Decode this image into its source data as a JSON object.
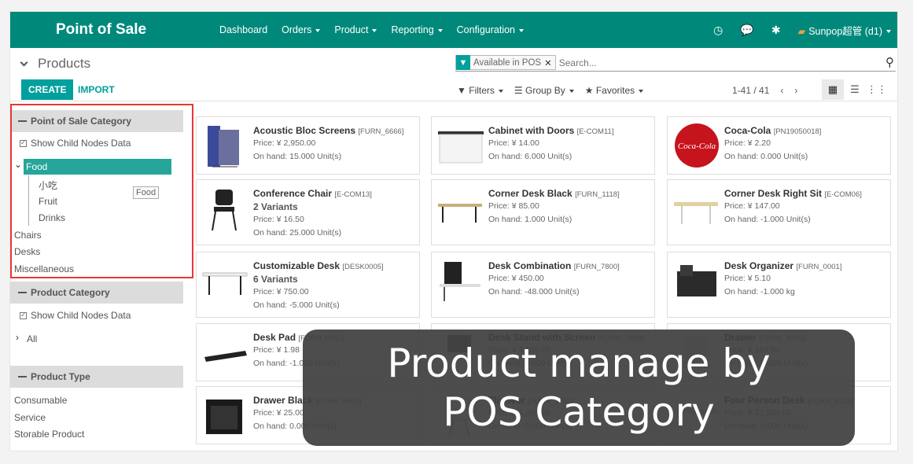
{
  "topbar": {
    "app_title": "Point of Sale",
    "menu": [
      "Dashboard",
      "Orders",
      "Product",
      "Reporting",
      "Configuration"
    ],
    "user": "Sunpop超管 (d1)",
    "color": "#00897b"
  },
  "control": {
    "breadcrumb": "Products",
    "create": "CREATE",
    "import": "IMPORT",
    "facet": "Available in POS",
    "search_placeholder": "Search...",
    "filters": "Filters",
    "group_by": "Group By",
    "favorites": "Favorites",
    "pager": "1-41 / 41"
  },
  "sidebar": {
    "pos_category": {
      "title": "Point of Sale Category",
      "show_child": "Show Child Nodes Data",
      "selected": "Food",
      "children": [
        "小吃",
        "Fruit",
        "Drinks"
      ],
      "others": [
        "Chairs",
        "Desks",
        "Miscellaneous"
      ],
      "tooltip": "Food"
    },
    "product_category": {
      "title": "Product Category",
      "show_child": "Show Child Nodes Data",
      "all": "All"
    },
    "product_type": {
      "title": "Product Type",
      "items": [
        "Consumable",
        "Service",
        "Storable Product"
      ]
    }
  },
  "cards": [
    {
      "name": "Acoustic Bloc Screens",
      "ref": "[FURN_6666]",
      "price": "Price: ¥ 2,950.00",
      "onhand": "On hand: 15.000 Unit(s)"
    },
    {
      "name": "Cabinet with Doors",
      "ref": "[E-COM11]",
      "price": "Price: ¥ 14.00",
      "onhand": "On hand: 6.000 Unit(s)"
    },
    {
      "name": "Coca-Cola",
      "ref": "[PN19050018]",
      "price": "Price: ¥ 2.20",
      "onhand": "On hand: 0.000 Unit(s)"
    },
    {
      "name": "Conference Chair",
      "ref": "[E-COM13]",
      "variants": "2 Variants",
      "price": "Price: ¥ 16.50",
      "onhand": "On hand: 25.000 Unit(s)"
    },
    {
      "name": "Corner Desk Black",
      "ref": "[FURN_1118]",
      "price": "Price: ¥ 85.00",
      "onhand": "On hand: 1.000 Unit(s)"
    },
    {
      "name": "Corner Desk Right Sit",
      "ref": "[E-COM06]",
      "price": "Price: ¥ 147.00",
      "onhand": "On hand: -1.000 Unit(s)"
    },
    {
      "name": "Customizable Desk",
      "ref": "[DESK0005]",
      "variants": "6 Variants",
      "price": "Price: ¥ 750.00",
      "onhand": "On hand: -5.000 Unit(s)"
    },
    {
      "name": "Desk Combination",
      "ref": "[FURN_7800]",
      "price": "Price: ¥ 450.00",
      "onhand": "On hand: -48.000 Unit(s)"
    },
    {
      "name": "Desk Organizer",
      "ref": "[FURN_0001]",
      "price": "Price: ¥ 5.10",
      "onhand": "On hand: -1.000 kg"
    },
    {
      "name": "Desk Pad",
      "ref": "[FURN_0002]",
      "price": "Price: ¥ 1.98",
      "onhand": "On hand: -1.000 Unit(s)"
    },
    {
      "name": "Desk Stand with Screen",
      "ref": "[FURN_7888]",
      "price": "Price: ¥ 2,100.00",
      "onhand": "On hand: 0.000 Unit(s)"
    },
    {
      "name": "Drawer",
      "ref": "[FURN_8855]",
      "price": "Price: ¥ 110.50",
      "onhand": "On hand: 0.000 Unit(s)"
    },
    {
      "name": "Drawer Black",
      "ref": "[FURN_8900]",
      "price": "Price: ¥ 25.00",
      "onhand": "On hand: 0.000 Unit(s)"
    },
    {
      "name": "Flipover",
      "ref": "[FURN_9001]",
      "price": "Price: ¥ 1,950.00",
      "onhand": "On hand: 0.000 Unit(s)"
    },
    {
      "name": "Four Person Desk",
      "ref": "[FURN_8220]",
      "price": "Price: ¥ 23,500.00",
      "onhand": "On hand: 0.000 Unit(s)"
    }
  ],
  "overlay": {
    "line1": "Product manage by",
    "line2": "POS Category"
  }
}
